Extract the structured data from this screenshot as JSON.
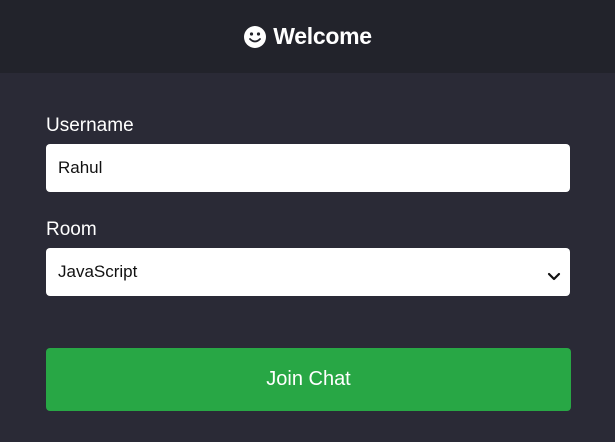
{
  "header": {
    "icon": "smile-icon",
    "title": "Welcome"
  },
  "form": {
    "username_label": "Username",
    "username_value": "Rahul",
    "room_label": "Room",
    "room_selected": "JavaScript",
    "submit_label": "Join Chat"
  },
  "colors": {
    "header_bg": "#22232b",
    "page_bg": "#2a2a36",
    "button_bg": "#28a745"
  }
}
